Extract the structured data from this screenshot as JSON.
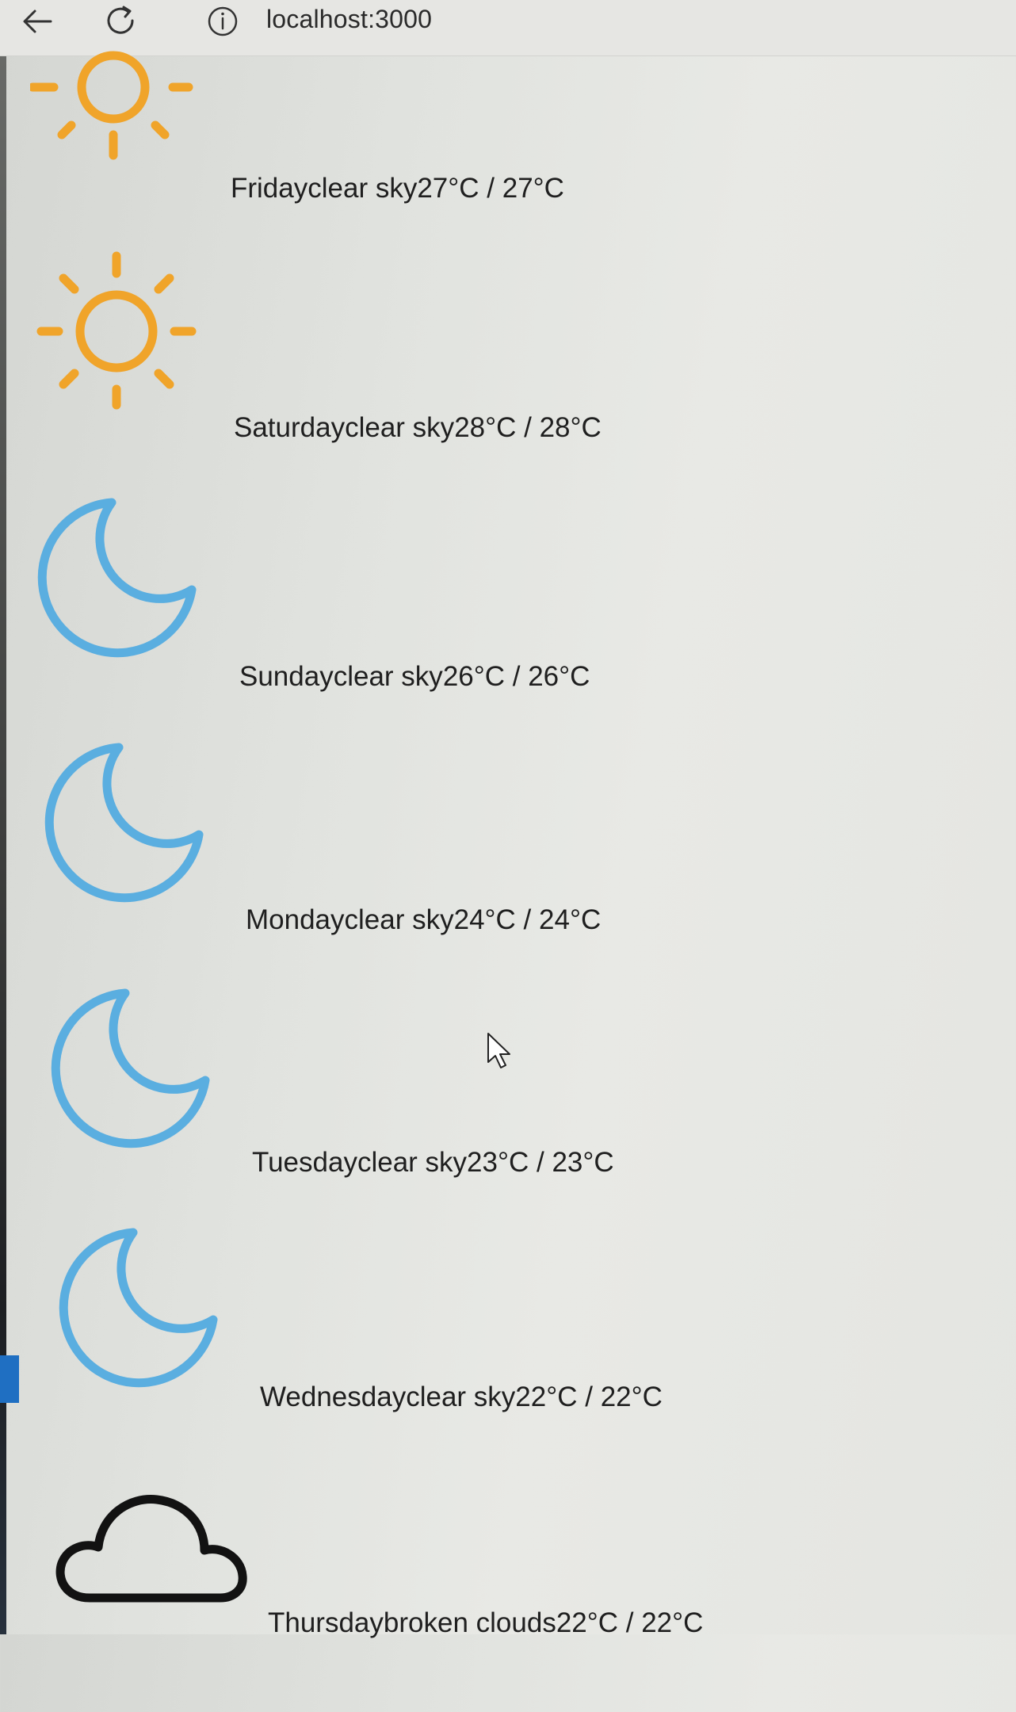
{
  "browser": {
    "url": "localhost:3000"
  },
  "forecast": [
    {
      "day": "Friday",
      "description": "clear sky",
      "temp_max": "27°C",
      "separator": " / ",
      "temp_min": "27°C",
      "icon": "sun-icon"
    },
    {
      "day": "Saturday",
      "description": "clear sky",
      "temp_max": "28°C",
      "separator": " / ",
      "temp_min": "28°C",
      "icon": "sun-icon"
    },
    {
      "day": "Sunday",
      "description": "clear sky",
      "temp_max": "26°C",
      "separator": " / ",
      "temp_min": "26°C",
      "icon": "moon-icon"
    },
    {
      "day": "Monday",
      "description": "clear sky",
      "temp_max": "24°C",
      "separator": " / ",
      "temp_min": "24°C",
      "icon": "moon-icon"
    },
    {
      "day": "Tuesday",
      "description": "clear sky",
      "temp_max": "23°C",
      "separator": " / ",
      "temp_min": "23°C",
      "icon": "moon-icon"
    },
    {
      "day": "Wednesday",
      "description": "clear sky",
      "temp_max": "22°C",
      "separator": " / ",
      "temp_min": "22°C",
      "icon": "moon-icon"
    },
    {
      "day": "Thursday",
      "description": "broken clouds",
      "temp_max": "22°C",
      "separator": " / ",
      "temp_min": "22°C",
      "icon": "cloud-icon"
    }
  ],
  "colors": {
    "sun": "#f0a42a",
    "moon": "#5aaee0",
    "cloud": "#121212"
  }
}
